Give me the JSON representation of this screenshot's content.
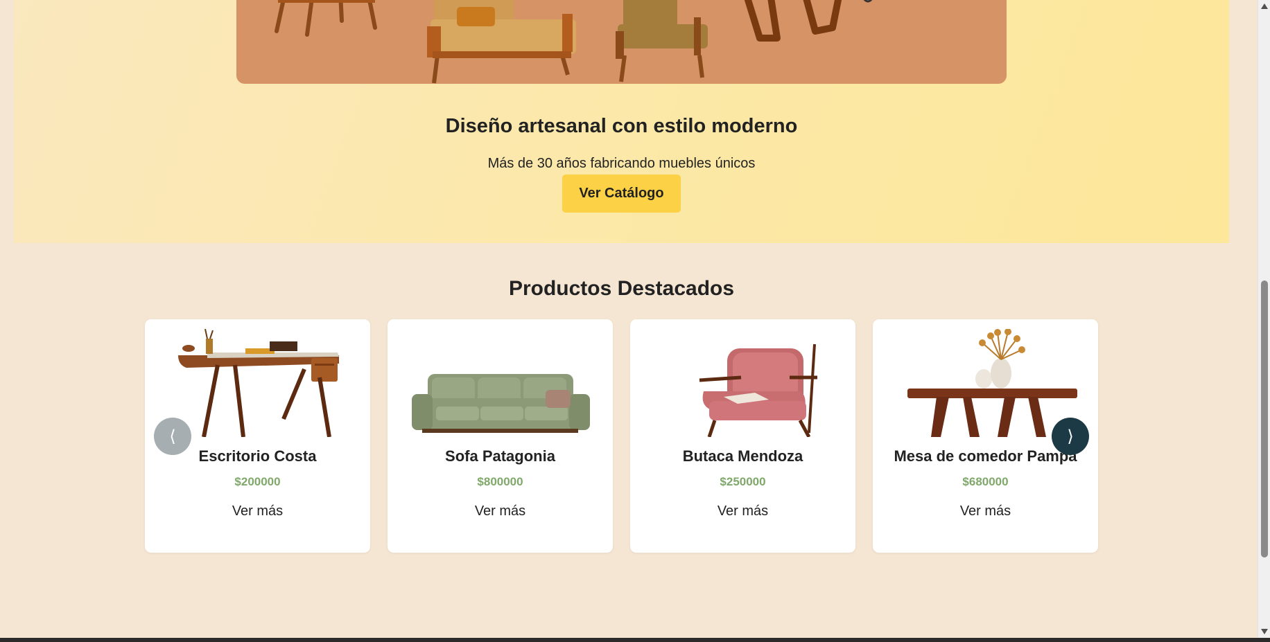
{
  "hero": {
    "title": "Diseño artesanal con estilo moderno",
    "subtitle": "Más de 30 años fabricando muebles únicos",
    "cta_label": "Ver Catálogo"
  },
  "featured": {
    "title": "Productos Destacados",
    "prev_icon": "⟨",
    "next_icon": "⟩",
    "products": [
      {
        "name": "Escritorio Costa",
        "price": "$200000",
        "more": "Ver más",
        "image": "desk-image"
      },
      {
        "name": "Sofa Patagonia",
        "price": "$800000",
        "more": "Ver más",
        "image": "sofa-image"
      },
      {
        "name": "Butaca Mendoza",
        "price": "$250000",
        "more": "Ver más",
        "image": "armchair-image"
      },
      {
        "name": "Mesa de comedor Pampa",
        "price": "$680000",
        "more": "Ver más",
        "image": "dining-table-image"
      }
    ]
  },
  "colors": {
    "page_bg": "#f5e6d3",
    "hero_bg": "#fce8a6",
    "hero_image_bg": "#d59366",
    "cta_bg": "#fdd146",
    "price": "#7fa86a",
    "next_button": "#1c3a45"
  }
}
